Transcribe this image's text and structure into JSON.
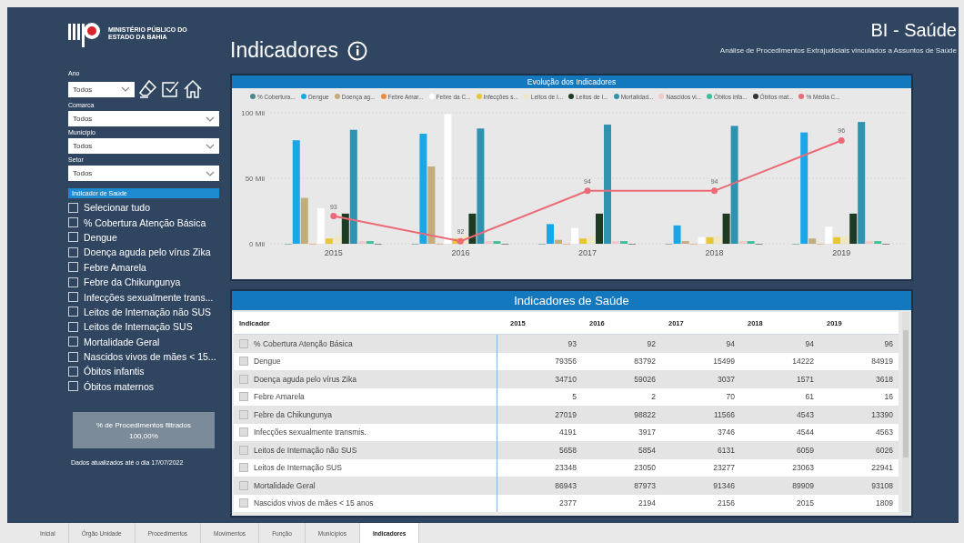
{
  "header": {
    "logo_text": "MINISTÉRIO PÚBLICO DO ESTADO DA BAHIA",
    "page_title": "Indicadores",
    "app_title": "BI - Saúde",
    "subtitle": "Análise de Procedimentos Extrajudiciais vinculados a Assuntos de Saúde"
  },
  "filters": [
    {
      "label": "Ano",
      "value": "Todos"
    },
    {
      "label": "Comarca",
      "value": "Todos"
    },
    {
      "label": "Município",
      "value": "Todos"
    },
    {
      "label": "Setor",
      "value": "Todos"
    }
  ],
  "indicator_filter": {
    "title": "Indicador de Saúde",
    "items": [
      {
        "label": "Selecionar tudo",
        "checked": false
      },
      {
        "label": "% Cobertura Atenção Básica",
        "checked": false
      },
      {
        "label": "Dengue",
        "checked": false
      },
      {
        "label": "Doença aguda pelo vírus Zika",
        "checked": false
      },
      {
        "label": "Febre Amarela",
        "checked": false
      },
      {
        "label": "Febre da Chikungunya",
        "checked": false
      },
      {
        "label": "Infecções sexualmente trans...",
        "checked": false
      },
      {
        "label": "Leitos de Internação não SUS",
        "checked": false
      },
      {
        "label": "Leitos de Internação SUS",
        "checked": false
      },
      {
        "label": "Mortalidade Geral",
        "checked": false
      },
      {
        "label": "Nascidos vivos de mães < 15...",
        "checked": false
      },
      {
        "label": "Óbitos infantis",
        "checked": false
      },
      {
        "label": "Óbitos maternos",
        "checked": false
      }
    ]
  },
  "card": {
    "label": "% de Procedimentos filtrados",
    "value": "100,00%"
  },
  "updated_note": "Dados atualizados até o dia 17/07/2022",
  "chart": {
    "title": "Evolução dos Indicadores",
    "chart_data": {
      "type": "bar",
      "categories": [
        "2015",
        "2016",
        "2017",
        "2018",
        "2019"
      ],
      "ylim": [
        0,
        100
      ],
      "yticks": [
        {
          "value": 0,
          "label": "0 Mil"
        },
        {
          "value": 50,
          "label": "50 Mil"
        },
        {
          "value": 100,
          "label": "100 Mil"
        }
      ],
      "series": [
        {
          "name": "% Cobertura...",
          "color": "#4a8a8f",
          "values": [
            0,
            0,
            0,
            0,
            0
          ]
        },
        {
          "name": "Dengue",
          "color": "#19a7e8",
          "values": [
            79,
            84,
            15,
            14,
            85
          ]
        },
        {
          "name": "Doença ag...",
          "color": "#c2ab7d",
          "values": [
            35,
            59,
            3,
            2,
            4
          ]
        },
        {
          "name": "Febre Amar...",
          "color": "#f08a3c",
          "values": [
            0,
            0,
            0,
            0,
            0
          ]
        },
        {
          "name": "Febre da C...",
          "color": "#ffffff",
          "values": [
            27,
            99,
            12,
            5,
            13
          ]
        },
        {
          "name": "Infecções s...",
          "color": "#e8c532",
          "values": [
            4,
            4,
            4,
            5,
            5
          ]
        },
        {
          "name": "Leitos de I...",
          "color": "#efe6c4",
          "values": [
            6,
            6,
            6,
            6,
            6
          ]
        },
        {
          "name": "Leitos de I...",
          "color": "#1d3a22",
          "values": [
            23,
            23,
            23,
            23,
            23
          ]
        },
        {
          "name": "Mortalidad...",
          "color": "#2f93b0",
          "values": [
            87,
            88,
            91,
            90,
            93
          ]
        },
        {
          "name": "Nascidos vi...",
          "color": "#f0c8c8",
          "values": [
            2,
            2,
            2,
            2,
            2
          ]
        },
        {
          "name": "Óbitos infa...",
          "color": "#3dbf9c",
          "values": [
            2,
            2,
            2,
            2,
            2
          ]
        },
        {
          "name": "Óbitos mat...",
          "color": "#333333",
          "values": [
            0,
            0,
            0,
            0,
            0
          ]
        }
      ]
    },
    "line": {
      "name": "% Média C...",
      "color": "#ec6a75",
      "labels": [
        "93",
        "92",
        "94",
        "94",
        "96"
      ]
    }
  },
  "table": {
    "title": "Indicadores de Saúde",
    "columns": [
      "Indicador",
      "2015",
      "2016",
      "2017",
      "2018",
      "2019"
    ],
    "rows": [
      [
        "% Cobertura Atenção Básica",
        "93",
        "92",
        "94",
        "94",
        "96"
      ],
      [
        "Dengue",
        "79356",
        "83792",
        "15499",
        "14222",
        "84919"
      ],
      [
        "Doença aguda pelo vírus Zika",
        "34710",
        "59026",
        "3037",
        "1571",
        "3618"
      ],
      [
        "Febre Amarela",
        "5",
        "2",
        "70",
        "61",
        "16"
      ],
      [
        "Febre da Chikungunya",
        "27019",
        "98822",
        "11566",
        "4543",
        "13390"
      ],
      [
        "Infecções sexualmente transmis.",
        "4191",
        "3917",
        "3746",
        "4544",
        "4563"
      ],
      [
        "Leitos de Internação não SUS",
        "5658",
        "5854",
        "6131",
        "6059",
        "6026"
      ],
      [
        "Leitos de Internação SUS",
        "23348",
        "23050",
        "23277",
        "23063",
        "22941"
      ],
      [
        "Mortalidade Geral",
        "86943",
        "87973",
        "91346",
        "89909",
        "93108"
      ],
      [
        "Nascidos vivos de mães < 15 anos",
        "2377",
        "2194",
        "2156",
        "2015",
        "1809"
      ]
    ]
  },
  "page_tabs": [
    {
      "label": "Inicial",
      "selected": false
    },
    {
      "label": "Órgão Unidade",
      "selected": false
    },
    {
      "label": "Procedimentos",
      "selected": false
    },
    {
      "label": "Movimentos",
      "selected": false
    },
    {
      "label": "Função",
      "selected": false
    },
    {
      "label": "Municípios",
      "selected": false
    },
    {
      "label": "Indicadores",
      "selected": true
    }
  ]
}
